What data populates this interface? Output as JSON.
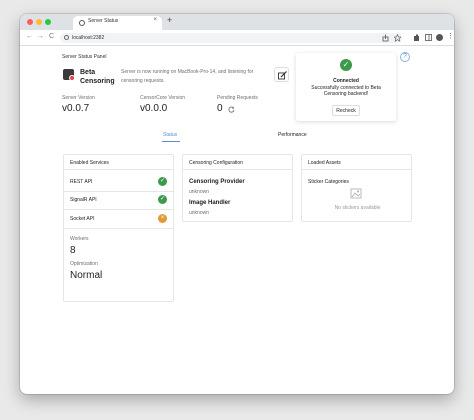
{
  "browser": {
    "tab_title": "Server Status",
    "tab_close": "×",
    "new_tab": "+",
    "url": "localhost:2382",
    "nav_back": "←",
    "nav_forward": "→",
    "nav_reload": "C"
  },
  "panel": {
    "title": "Server Status Panel",
    "app_name": "Beta Censoring",
    "running_text": "Server is now running on MacBook-Pro-14, and listening for censoring requests."
  },
  "stats": [
    {
      "label": "Server Version",
      "value": "v0.0.7"
    },
    {
      "label": "CensorCore Version",
      "value": "v0.0.0"
    },
    {
      "label": "Pending Requests",
      "value": "0"
    }
  ],
  "connection": {
    "status": "Connected",
    "message": "Successfully connected to Beta Censoring backend!",
    "recheck_label": "Recheck"
  },
  "help_icon_glyph": "?",
  "tabs": [
    {
      "label": "Status",
      "active": true
    },
    {
      "label": "Performance",
      "active": false
    }
  ],
  "services": {
    "title": "Enabled Services",
    "items": [
      {
        "label": "REST API",
        "state": "ok",
        "glyph": "✓"
      },
      {
        "label": "SignalR API",
        "state": "ok",
        "glyph": "✓"
      },
      {
        "label": "Socket API",
        "state": "warn",
        "glyph": "×"
      }
    ],
    "workers_label": "Workers",
    "workers_value": "8",
    "optimization_label": "Optimization",
    "optimization_value": "Normal"
  },
  "censoring": {
    "title": "Censoring Configuration",
    "provider_label": "Censoring Provider",
    "provider_value": "unknown",
    "handler_label": "Image Handler",
    "handler_value": "unknown"
  },
  "assets": {
    "title": "Loaded Assets",
    "sticker_label": "Sticker Categories",
    "empty_text": "No stickers available"
  },
  "colors": {
    "accent": "#5b8fc9",
    "success": "#3c9a4a",
    "warning": "#e29a36",
    "close": "#ff5f57",
    "minimize": "#febc2e",
    "maximize": "#28c840"
  }
}
